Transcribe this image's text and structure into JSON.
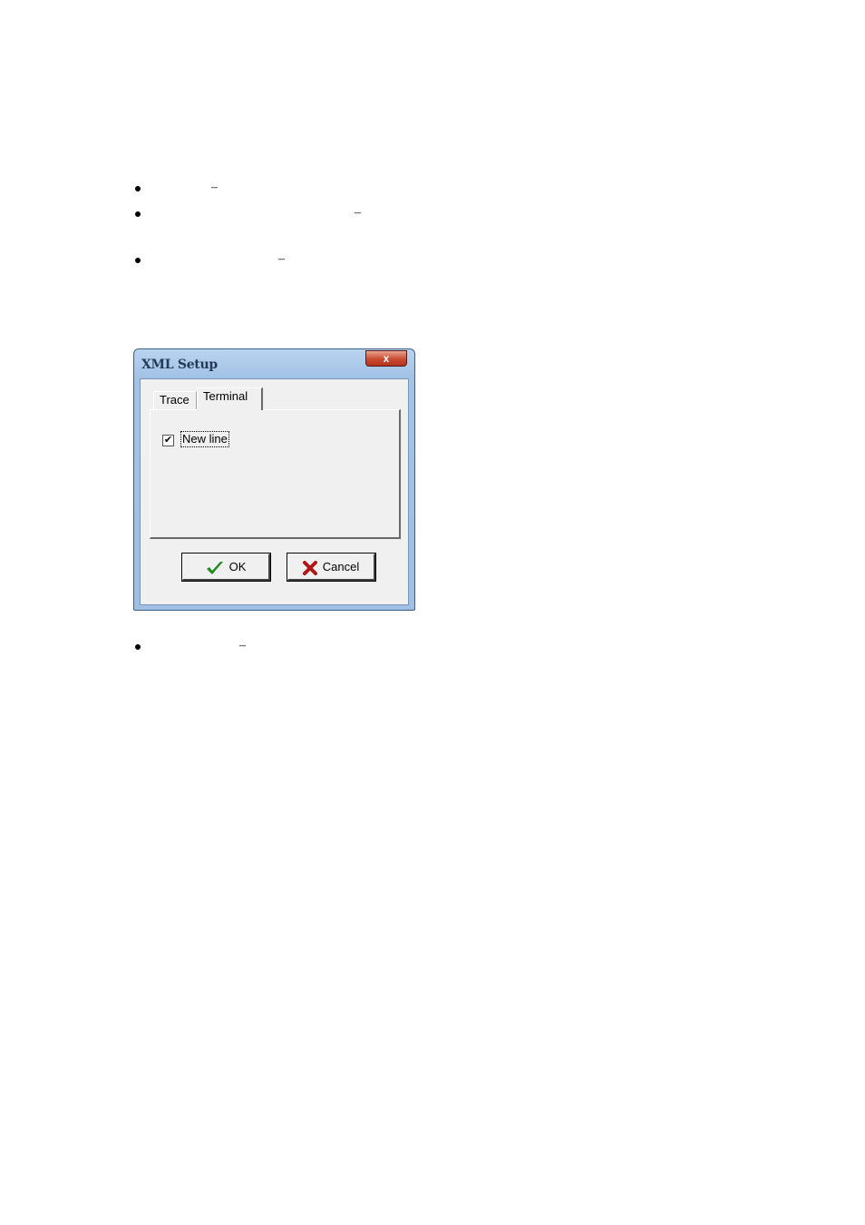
{
  "bullets": [
    {
      "dash": "–"
    },
    {
      "dash": "–"
    },
    {
      "dash": "–"
    },
    {
      "dash": "–"
    }
  ],
  "dialog": {
    "title": "XML Setup",
    "close_label": "x",
    "tabs": [
      {
        "label": "Trace",
        "active": false
      },
      {
        "label": "Terminal",
        "active": true
      }
    ],
    "checkbox": {
      "label": "New line",
      "checked": true,
      "mark": "✔"
    },
    "ok_label": "OK",
    "cancel_label": "Cancel"
  },
  "colors": {
    "titlebar": "#a3c3e6",
    "close_button": "#c94a31",
    "ok_icon": "#1f8a1f",
    "cancel_icon": "#b01818"
  }
}
